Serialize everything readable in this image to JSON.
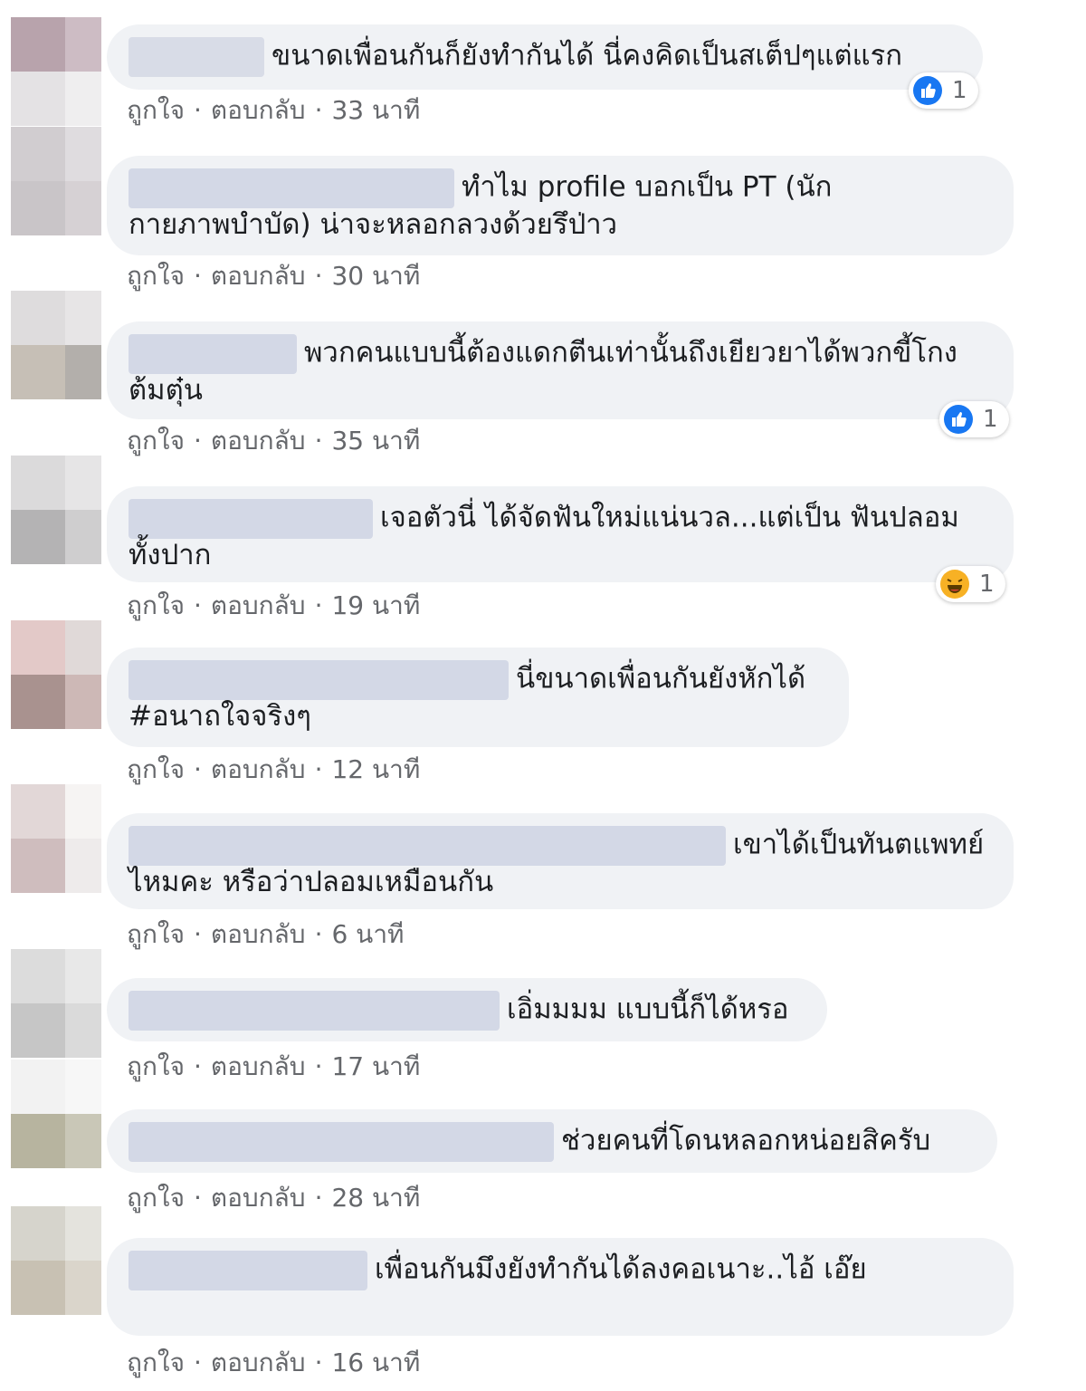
{
  "actions": {
    "like": "ถูกใจ",
    "reply": "ตอบกลับ"
  },
  "comments": [
    {
      "text": "ขนาดเพื่อนกันก็ยังทำกันได้ นี่คงคิดเป็นสเต็ปๆแต่แรก",
      "time": "33 นาที",
      "reaction": {
        "icon": "like-icon",
        "count": "1"
      }
    },
    {
      "text": "ทำไม profile บอกเป็น PT (นักกายภาพบำบัด) น่าจะหลอกลวงด้วยรึป่าว",
      "time": "30 นาที"
    },
    {
      "text": "พวกคนแบบนี้ต้องแดกตีนเท่านั้นถึงเยียวยาได้พวกขี้โกงต้มตุ๋น",
      "time": "35 นาที",
      "reaction": {
        "icon": "like-icon",
        "count": "1"
      }
    },
    {
      "text": "เจอตัวนี่ ได้จัดฟันใหม่แน่นวล...แต่เป็น ฟันปลอมทั้งปาก",
      "time": "19 นาที",
      "reaction": {
        "icon": "haha-icon",
        "count": "1"
      }
    },
    {
      "text": "นี่ขนาดเพื่อนกันยังหักได้ #อนาถใจจริงๆ",
      "time": "12 นาที"
    },
    {
      "text": "เขาได้เป็นทันตแพทย์ไหมคะ หรือว่าปลอมเหมือนกัน",
      "time": "6 นาที"
    },
    {
      "text": "เอิ่มมมม แบบนี้ก็ได้หรอ",
      "time": "17 นาที"
    },
    {
      "text": "ช่วยคนที่โดนหลอกหน่อยสิครับ",
      "time": "28 นาที"
    },
    {
      "text": "เพื่อนกันมึงยังทำกันได้ลงคอเนาะ..ไอ้ เอ๊ย",
      "time": "16 นาที"
    }
  ],
  "colors": {
    "bubble": "#f0f2f5",
    "meta": "#65676b",
    "like_blue": "#1877f2",
    "haha_yellow": "#f7b125"
  }
}
